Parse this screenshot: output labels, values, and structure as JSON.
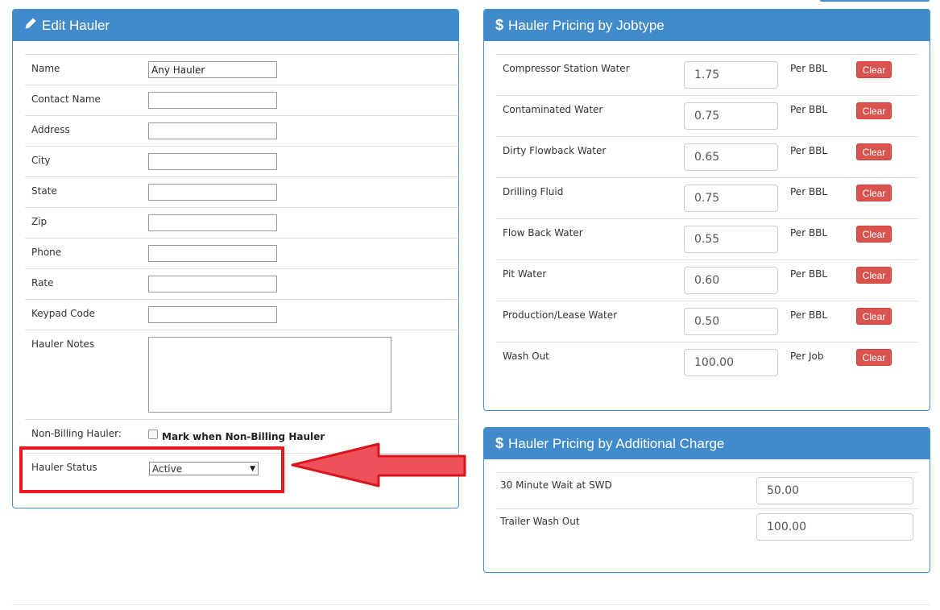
{
  "edit_hauler": {
    "title": "Edit Hauler",
    "icon": "pencil-icon",
    "fields": [
      {
        "label": "Name",
        "value": "Any Hauler"
      },
      {
        "label": "Contact Name",
        "value": ""
      },
      {
        "label": "Address",
        "value": ""
      },
      {
        "label": "City",
        "value": ""
      },
      {
        "label": "State",
        "value": ""
      },
      {
        "label": "Zip",
        "value": ""
      },
      {
        "label": "Phone",
        "value": ""
      },
      {
        "label": "Rate",
        "value": ""
      },
      {
        "label": "Keypad Code",
        "value": ""
      }
    ],
    "notes": {
      "label": "Hauler Notes",
      "value": ""
    },
    "non_billing": {
      "label": "Non-Billing Hauler:",
      "checkbox_label": "Mark when Non-Billing Hauler",
      "checked": false
    },
    "status": {
      "label": "Hauler Status",
      "selected": "Active"
    }
  },
  "jobtype_pricing": {
    "title": "Hauler Pricing by Jobtype",
    "icon": "dollar-icon",
    "clear_label": "Clear",
    "rows": [
      {
        "label": "Compressor Station Water",
        "value": "1.75",
        "unit": "Per BBL"
      },
      {
        "label": "Contaminated Water",
        "value": "0.75",
        "unit": "Per BBL"
      },
      {
        "label": "Dirty Flowback Water",
        "value": "0.65",
        "unit": "Per BBL"
      },
      {
        "label": "Drilling Fluid",
        "value": "0.75",
        "unit": "Per BBL"
      },
      {
        "label": "Flow Back Water",
        "value": "0.55",
        "unit": "Per BBL"
      },
      {
        "label": "Pit Water",
        "value": "0.60",
        "unit": "Per BBL"
      },
      {
        "label": "Production/Lease Water",
        "value": "0.50",
        "unit": "Per BBL"
      },
      {
        "label": "Wash Out",
        "value": "100.00",
        "unit": "Per Job"
      }
    ]
  },
  "additional_charge_pricing": {
    "title": "Hauler Pricing by Additional Charge",
    "icon": "dollar-icon",
    "rows": [
      {
        "label": "30 Minute Wait at SWD",
        "value": "50.00"
      },
      {
        "label": "Trailer Wash Out",
        "value": "100.00"
      }
    ]
  },
  "annotation": {
    "highlight_color": "#e8161d",
    "arrow_color": "#f0505a"
  }
}
